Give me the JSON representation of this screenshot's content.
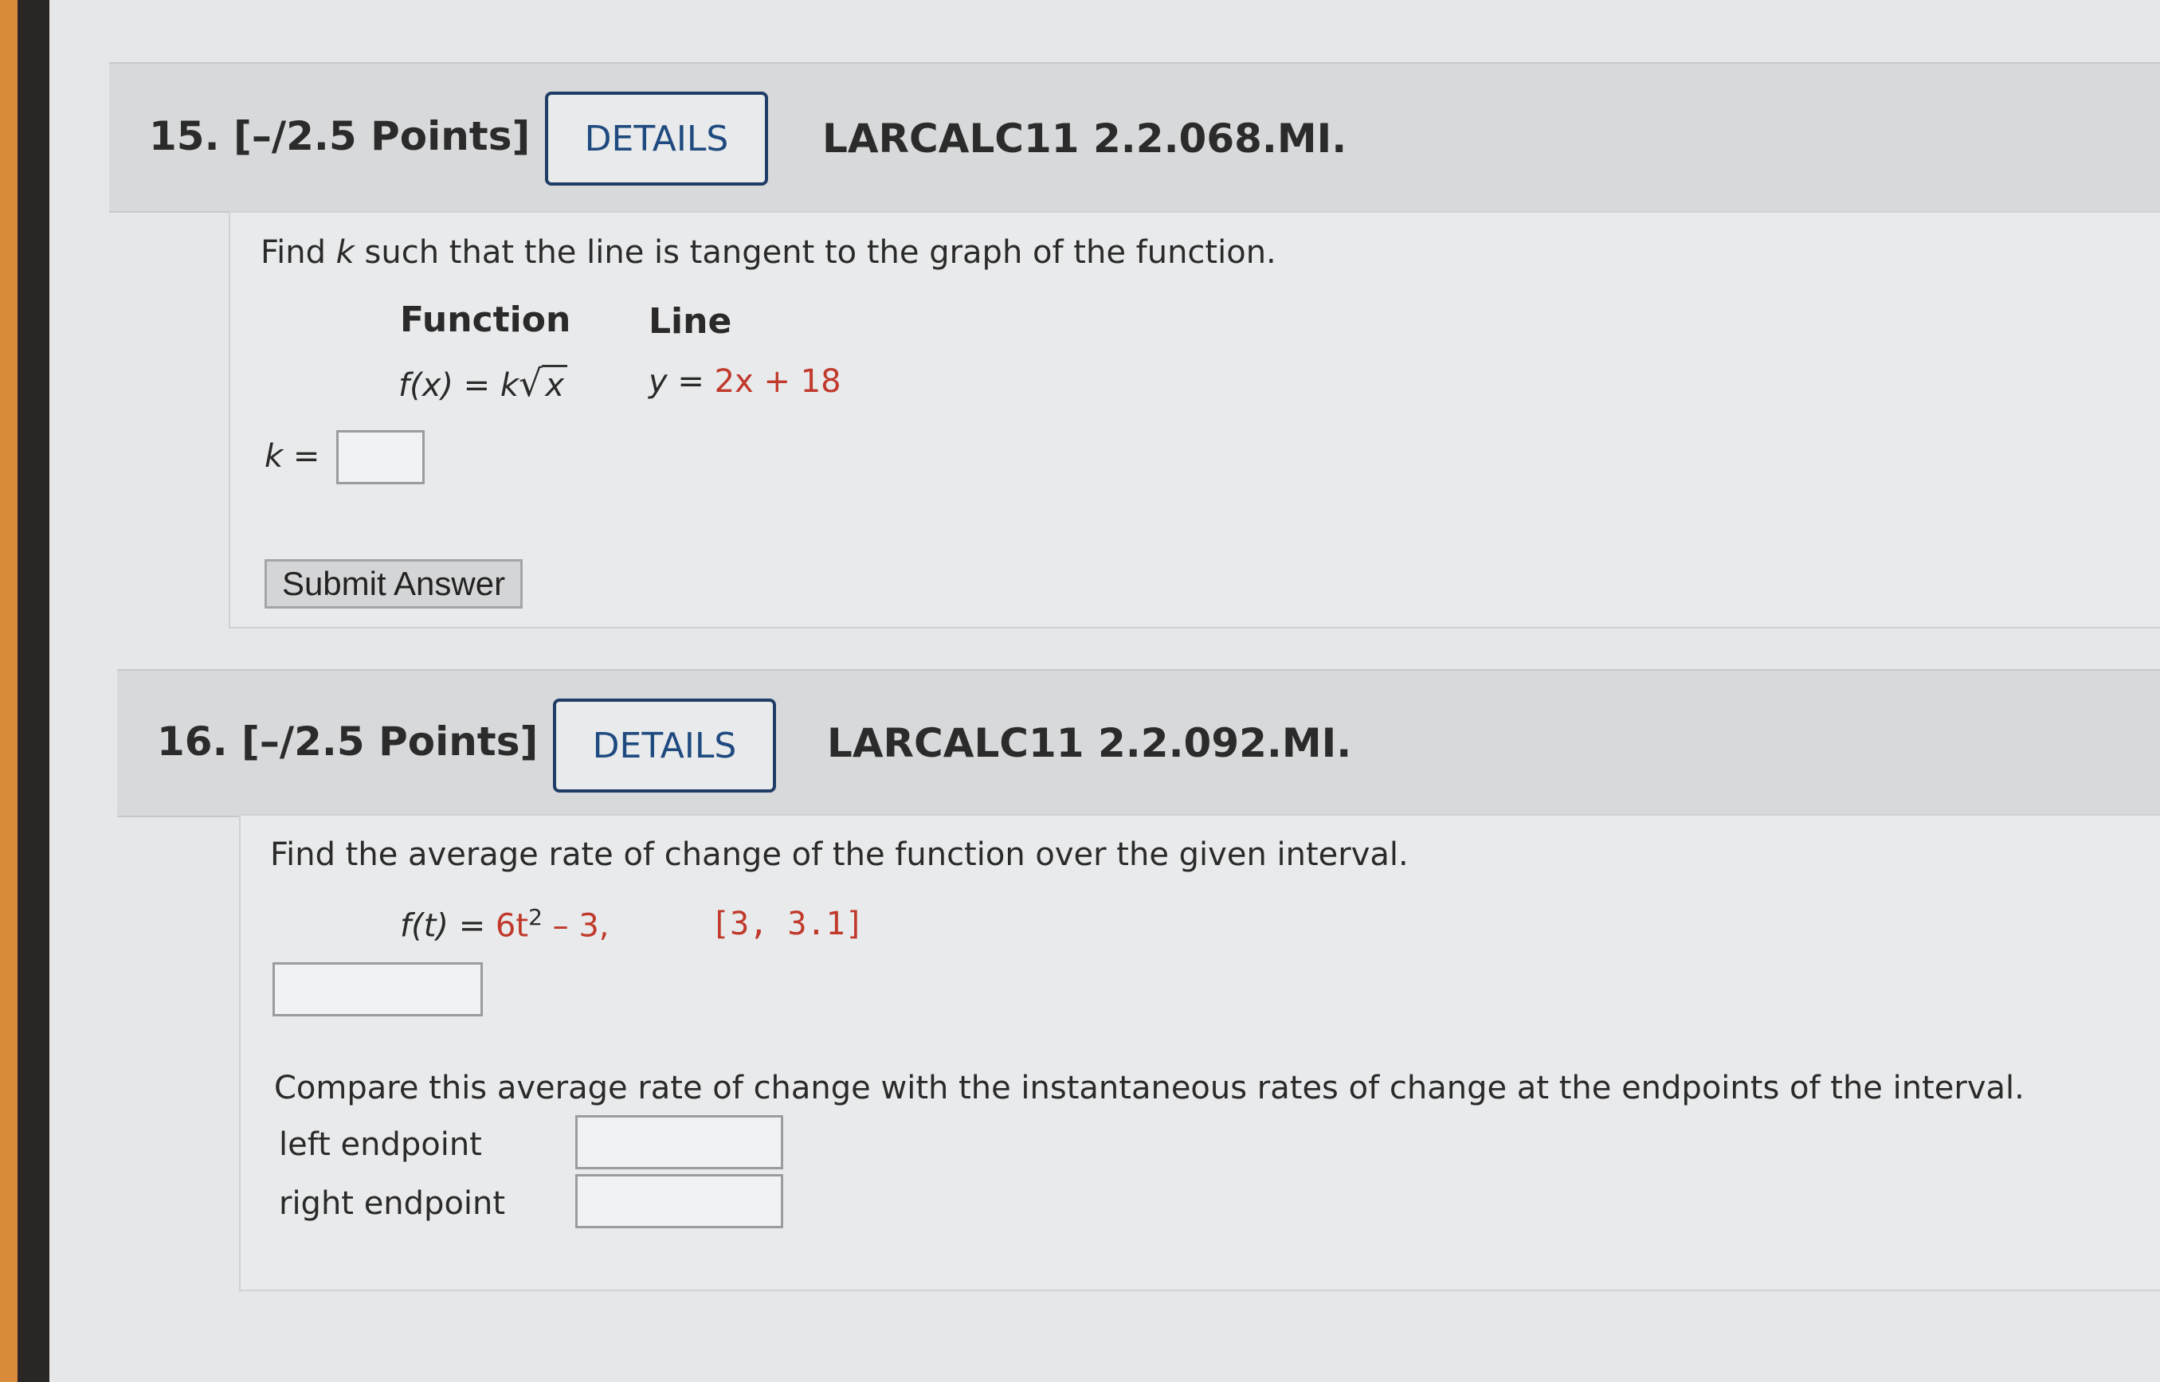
{
  "q15": {
    "title": "15. [–/2.5 Points]",
    "details_label": "DETAILS",
    "code": "LARCALC11 2.2.068.MI.",
    "prompt_a": "Find ",
    "prompt_k": "k",
    "prompt_b": " such that the line is tangent to the graph of the function.",
    "col_function": "Function",
    "col_line": "Line",
    "func_lhs": "f(x) = k",
    "func_sqrt_glyph": "√",
    "func_radicand": "x",
    "line_lhs": "y = ",
    "line_rhs": "2x + 18",
    "answer_label": "k =",
    "submit_label": "Submit Answer"
  },
  "q16": {
    "title": "16. [–/2.5 Points]",
    "details_label": "DETAILS",
    "code": "LARCALC11 2.2.092.MI.",
    "prompt": "Find the average rate of change of the function over the given interval.",
    "func_lhs": "f(t) = ",
    "func_coef": "6t",
    "func_exp": "2",
    "func_rest": " – 3,",
    "interval": "[3, 3.1]",
    "compare_prompt": "Compare this average rate of change with the instantaneous rates of change at the endpoints of the interval.",
    "left_label": "left endpoint",
    "right_label": "right endpoint"
  }
}
